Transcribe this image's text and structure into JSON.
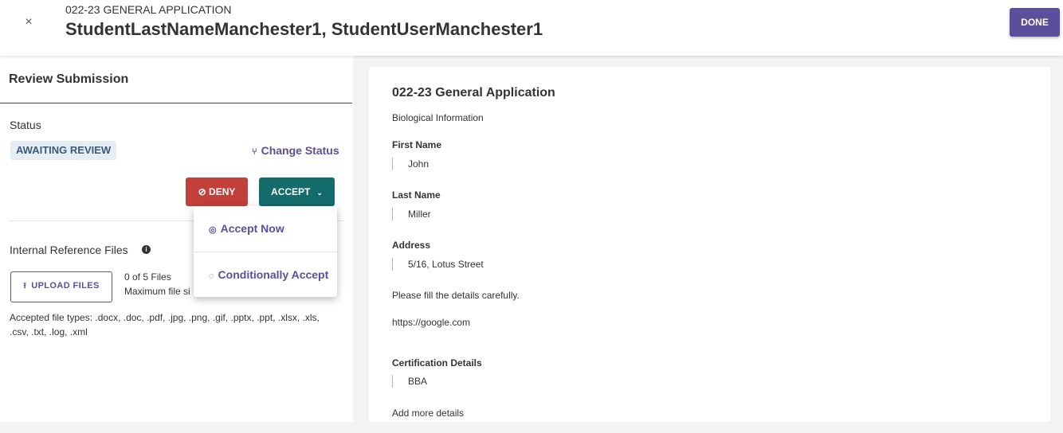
{
  "header": {
    "subtitle": "022-23 GENERAL APPLICATION",
    "title": "StudentLastNameManchester1, StudentUserManchester1",
    "close_symbol": "×",
    "done_label": "DONE"
  },
  "review": {
    "title": "Review Submission",
    "status_label": "Status",
    "status_value": "AWAITING REVIEW",
    "change_status_label": "Change Status",
    "deny_label": "DENY",
    "accept_label": "ACCEPT",
    "accept_menu": [
      {
        "label": "Accept Now",
        "icon": "check-circle-icon"
      },
      {
        "label": "Conditionally Accept",
        "icon": "dashed-check-circle-icon"
      }
    ],
    "files_label": "Internal Reference Files",
    "upload_label": "UPLOAD FILES",
    "file_count": "0 of 5 Files",
    "max_file_size": "Maximum file si",
    "accepted_types": "Accepted file types: .docx, .doc, .pdf, .jpg, .png, .gif, .pptx, .ppt, .xlsx, .xls, .csv, .txt, .log, .xml"
  },
  "application": {
    "title": "022-23 General Application",
    "section": "Biological Information",
    "fields": [
      {
        "label": "First Name",
        "value": "John"
      },
      {
        "label": "Last Name",
        "value": "Miller"
      },
      {
        "label": "Address",
        "value": "5/16, Lotus Street"
      }
    ],
    "note": "Please fill the details carefully.",
    "link": "https://google.com",
    "certification": {
      "label": "Certification Details",
      "value": "BBA"
    },
    "more": "Add more details"
  },
  "colors": {
    "primary": "#5b4e9b",
    "deny": "#c2403a",
    "accept": "#146b6b",
    "status_badge_bg": "#e4eef5"
  }
}
